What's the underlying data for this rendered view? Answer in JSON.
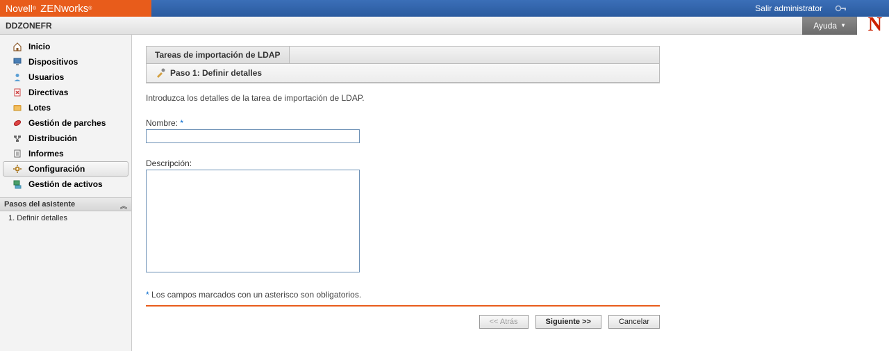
{
  "brand": {
    "novell": "Novell",
    "sub": "®",
    "zen": "ZENworks",
    "zensub": "®"
  },
  "header": {
    "logout": "Salir administrator",
    "zone": "DDZONEFR",
    "help": "Ayuda"
  },
  "nav": {
    "items": [
      {
        "label": "Inicio"
      },
      {
        "label": "Dispositivos"
      },
      {
        "label": "Usuarios"
      },
      {
        "label": "Directivas"
      },
      {
        "label": "Lotes"
      },
      {
        "label": "Gestión de parches"
      },
      {
        "label": "Distribución"
      },
      {
        "label": "Informes"
      },
      {
        "label": "Configuración"
      },
      {
        "label": "Gestión de activos"
      }
    ]
  },
  "wizard": {
    "title": "Pasos del asistente",
    "steps": [
      "1. Definir detalles"
    ]
  },
  "panel": {
    "tab": "Tareas de importación de LDAP",
    "step": "Paso 1: Definir detalles",
    "intro": "Introduzca los detalles de la tarea de importación de LDAP.",
    "name_label": "Nombre:",
    "desc_label": "Descripción:",
    "required_note": "Los campos marcados con un asterisco son obligatorios."
  },
  "buttons": {
    "back": "<< Atrás",
    "next": "Siguiente >>",
    "cancel": "Cancelar"
  }
}
